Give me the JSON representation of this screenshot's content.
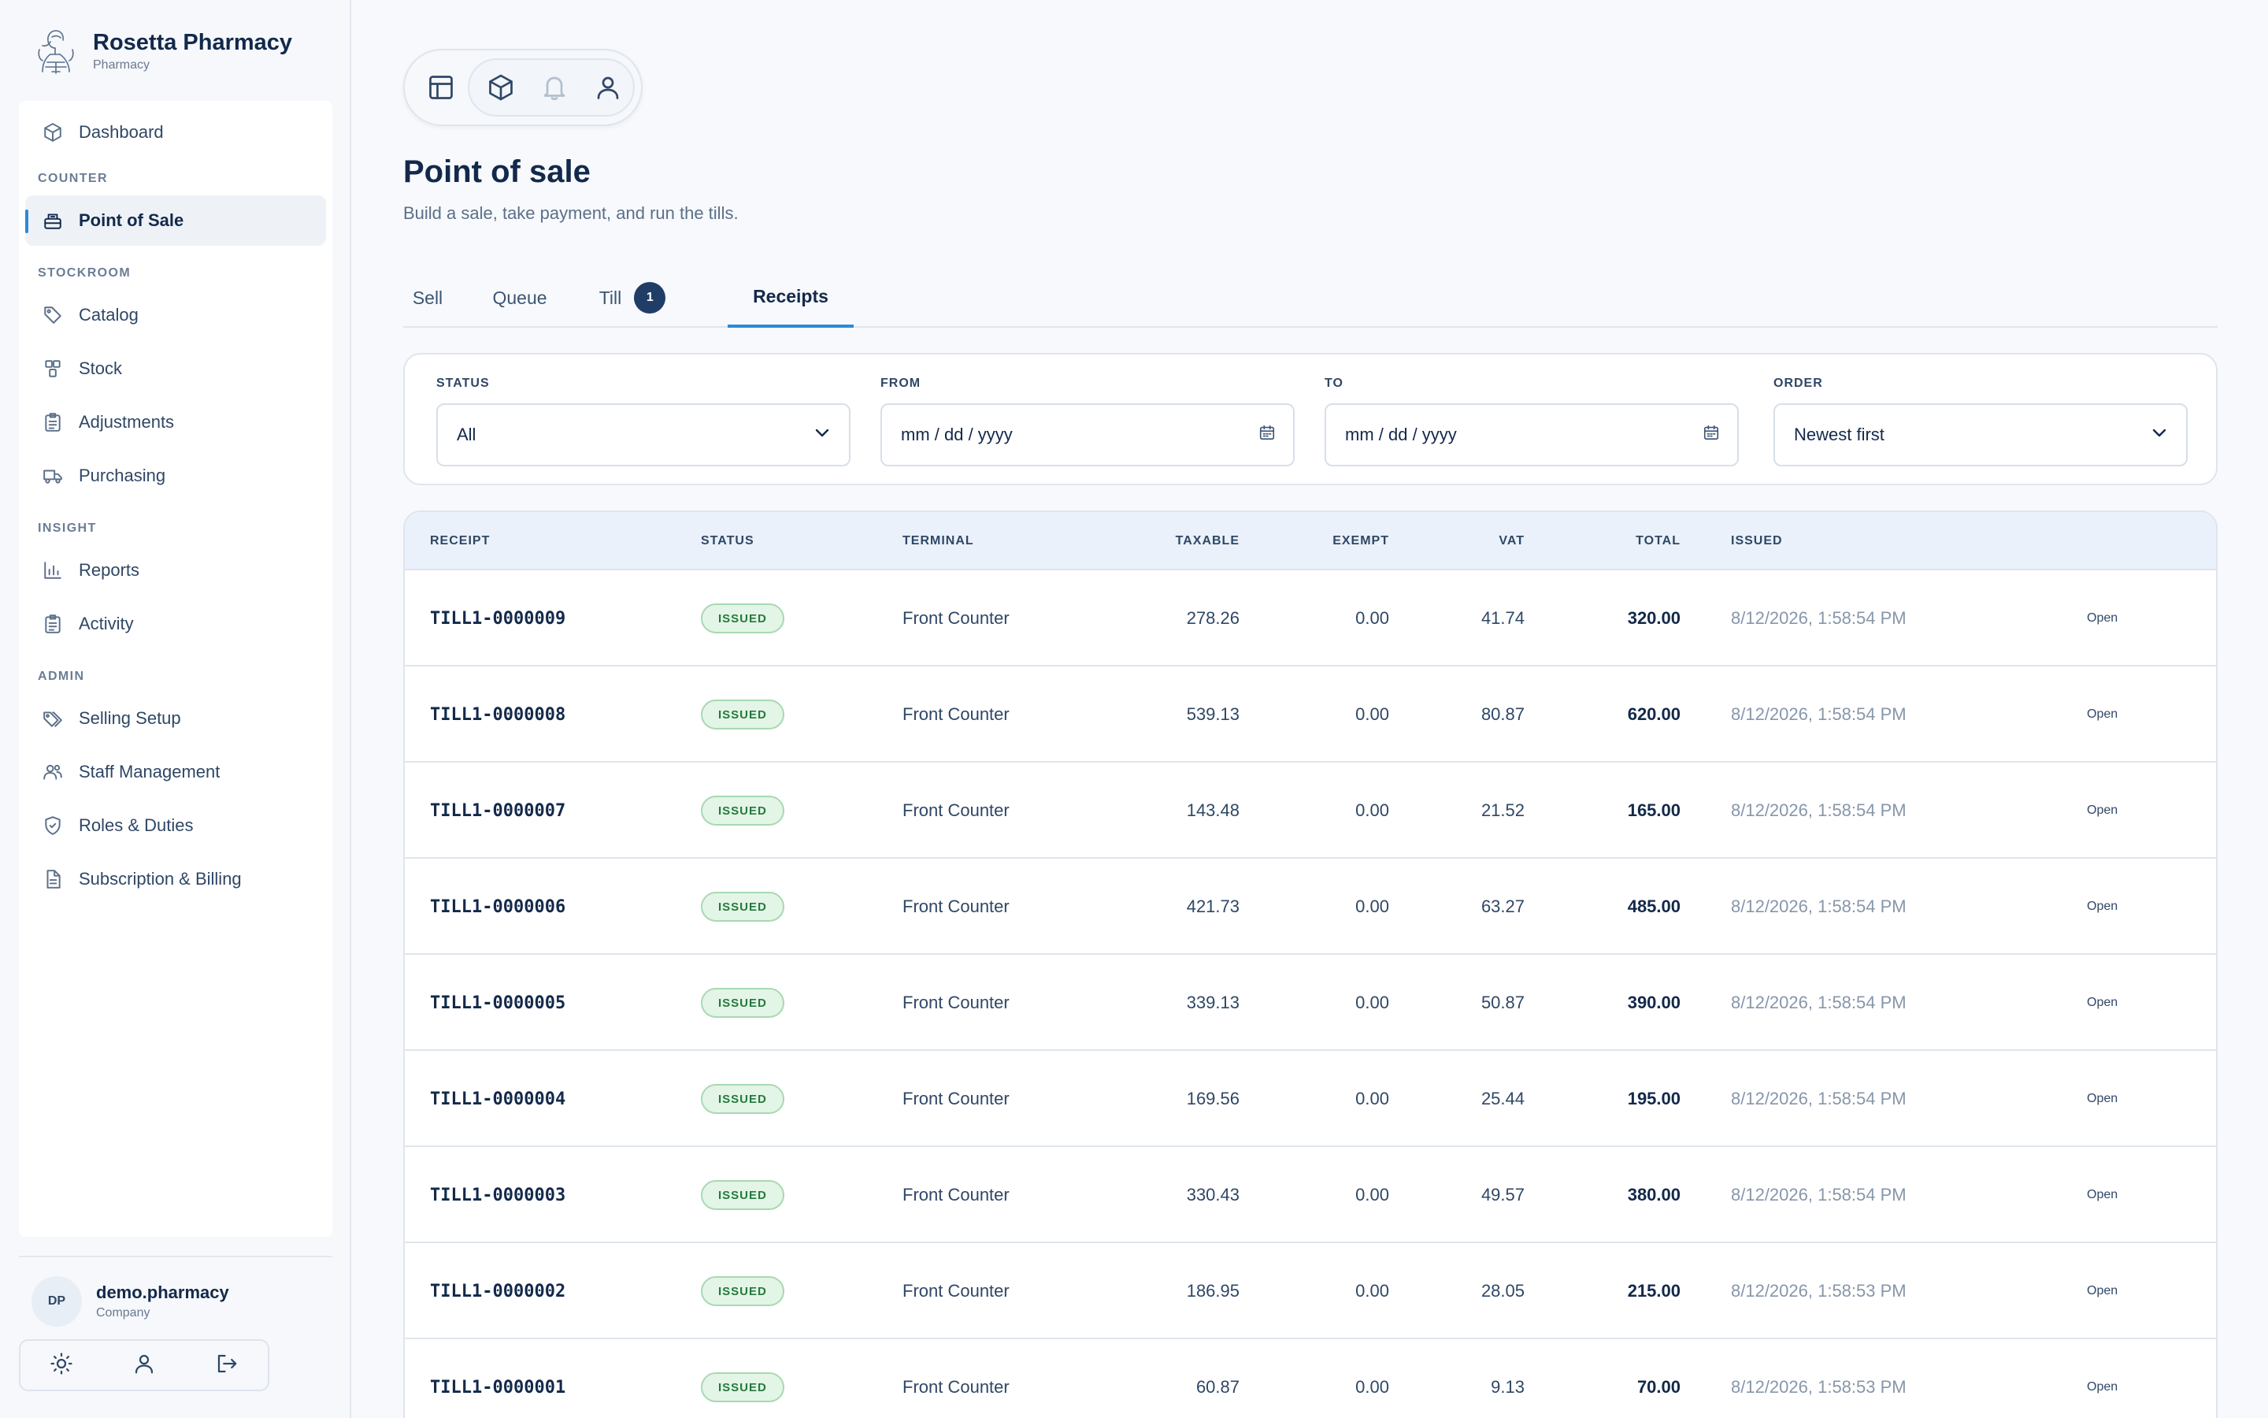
{
  "brand": {
    "name": "Rosetta Pharmacy",
    "subtitle": "Pharmacy"
  },
  "nav": {
    "dashboard": "Dashboard",
    "sections": {
      "counter": "COUNTER",
      "stockroom": "STOCKROOM",
      "insight": "INSIGHT",
      "admin": "ADMIN"
    },
    "items": {
      "point_of_sale": "Point of Sale",
      "catalog": "Catalog",
      "stock": "Stock",
      "adjustments": "Adjustments",
      "purchasing": "Purchasing",
      "reports": "Reports",
      "activity": "Activity",
      "selling_setup": "Selling Setup",
      "staff_management": "Staff Management",
      "roles_duties": "Roles & Duties",
      "subscription_billing": "Subscription & Billing"
    },
    "active": "point_of_sale"
  },
  "user": {
    "initials": "DP",
    "name": "demo.pharmacy",
    "role": "Company"
  },
  "page": {
    "title": "Point of sale",
    "subtitle": "Build a sale, take payment, and run the tills."
  },
  "tabs": {
    "sell": "Sell",
    "queue": "Queue",
    "till": "Till",
    "till_badge": "1",
    "receipts": "Receipts",
    "active": "receipts"
  },
  "filters": {
    "status_label": "STATUS",
    "status_value": "All",
    "from_label": "FROM",
    "from_value": "mm / dd / yyyy",
    "to_label": "TO",
    "to_value": "mm / dd / yyyy",
    "order_label": "ORDER",
    "order_value": "Newest first"
  },
  "table": {
    "headers": {
      "receipt": "RECEIPT",
      "status": "STATUS",
      "terminal": "TERMINAL",
      "taxable": "TAXABLE",
      "exempt": "EXEMPT",
      "vat": "VAT",
      "total": "TOTAL",
      "issued": "ISSUED"
    },
    "rows": [
      {
        "receipt": "TILL1-0000009",
        "status": "ISSUED",
        "terminal": "Front Counter",
        "taxable": "278.26",
        "exempt": "0.00",
        "vat": "41.74",
        "total": "320.00",
        "issued": "8/12/2026, 1:58:54 PM",
        "action": "Open"
      },
      {
        "receipt": "TILL1-0000008",
        "status": "ISSUED",
        "terminal": "Front Counter",
        "taxable": "539.13",
        "exempt": "0.00",
        "vat": "80.87",
        "total": "620.00",
        "issued": "8/12/2026, 1:58:54 PM",
        "action": "Open"
      },
      {
        "receipt": "TILL1-0000007",
        "status": "ISSUED",
        "terminal": "Front Counter",
        "taxable": "143.48",
        "exempt": "0.00",
        "vat": "21.52",
        "total": "165.00",
        "issued": "8/12/2026, 1:58:54 PM",
        "action": "Open"
      },
      {
        "receipt": "TILL1-0000006",
        "status": "ISSUED",
        "terminal": "Front Counter",
        "taxable": "421.73",
        "exempt": "0.00",
        "vat": "63.27",
        "total": "485.00",
        "issued": "8/12/2026, 1:58:54 PM",
        "action": "Open"
      },
      {
        "receipt": "TILL1-0000005",
        "status": "ISSUED",
        "terminal": "Front Counter",
        "taxable": "339.13",
        "exempt": "0.00",
        "vat": "50.87",
        "total": "390.00",
        "issued": "8/12/2026, 1:58:54 PM",
        "action": "Open"
      },
      {
        "receipt": "TILL1-0000004",
        "status": "ISSUED",
        "terminal": "Front Counter",
        "taxable": "169.56",
        "exempt": "0.00",
        "vat": "25.44",
        "total": "195.00",
        "issued": "8/12/2026, 1:58:54 PM",
        "action": "Open"
      },
      {
        "receipt": "TILL1-0000003",
        "status": "ISSUED",
        "terminal": "Front Counter",
        "taxable": "330.43",
        "exempt": "0.00",
        "vat": "49.57",
        "total": "380.00",
        "issued": "8/12/2026, 1:58:54 PM",
        "action": "Open"
      },
      {
        "receipt": "TILL1-0000002",
        "status": "ISSUED",
        "terminal": "Front Counter",
        "taxable": "186.95",
        "exempt": "0.00",
        "vat": "28.05",
        "total": "215.00",
        "issued": "8/12/2026, 1:58:53 PM",
        "action": "Open"
      },
      {
        "receipt": "TILL1-0000001",
        "status": "ISSUED",
        "terminal": "Front Counter",
        "taxable": "60.87",
        "exempt": "0.00",
        "vat": "9.13",
        "total": "70.00",
        "issued": "8/12/2026, 1:58:53 PM",
        "action": "Open"
      }
    ]
  },
  "icons": {
    "dock": [
      "layout-icon",
      "box-icon",
      "bell-icon",
      "user-icon"
    ],
    "user_actions": [
      "sun-icon",
      "user-icon",
      "logout-icon"
    ]
  },
  "colors": {
    "accent": "#2a8bd8",
    "brand": "#13294b",
    "issued_badge_bg": "#e3f5e6",
    "issued_badge_text": "#257a3e"
  }
}
